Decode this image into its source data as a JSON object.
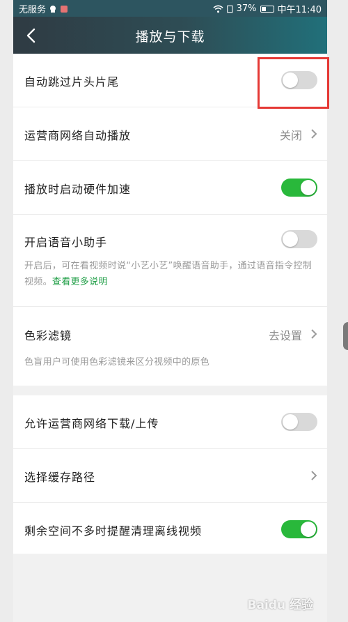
{
  "status_bar": {
    "carrier": "无服务",
    "battery_percent": "37%",
    "time": "中午11:40"
  },
  "header": {
    "title": "播放与下载"
  },
  "settings_group_1": [
    {
      "label": "自动跳过片头片尾",
      "control": "toggle",
      "state": "off"
    },
    {
      "label": "运营商网络自动播放",
      "control": "link",
      "value": "关闭"
    },
    {
      "label": "播放时启动硬件加速",
      "control": "toggle",
      "state": "on"
    },
    {
      "label": "开启语音小助手",
      "control": "toggle",
      "state": "off",
      "description": "开启后，可在看视频时说“小艺小艺”唤醒语音助手，通过语音指令控制视频。",
      "description_link": "查看更多说明"
    },
    {
      "label": "色彩滤镜",
      "control": "link",
      "value": "去设置",
      "description": "色盲用户可使用色彩滤镜来区分视频中的原色"
    }
  ],
  "settings_group_2": [
    {
      "label": "允许运营商网络下载/上传",
      "control": "toggle",
      "state": "off"
    },
    {
      "label": "选择缓存路径",
      "control": "link",
      "value": ""
    },
    {
      "label": "剩余空间不多时提醒清理离线视频",
      "control": "toggle",
      "state": "on"
    }
  ],
  "watermark": "Baidu 经验",
  "colors": {
    "header_start": "#2f3b43",
    "header_end": "#21707a",
    "toggle_on": "#29b83b",
    "toggle_off": "#d9d9d9",
    "link_green": "#1f9e46",
    "highlight_red": "#e53935"
  },
  "icons": {
    "back": "back-arrow-icon",
    "chevron": "chevron-right-icon",
    "wifi": "wifi-icon",
    "battery": "battery-icon"
  }
}
